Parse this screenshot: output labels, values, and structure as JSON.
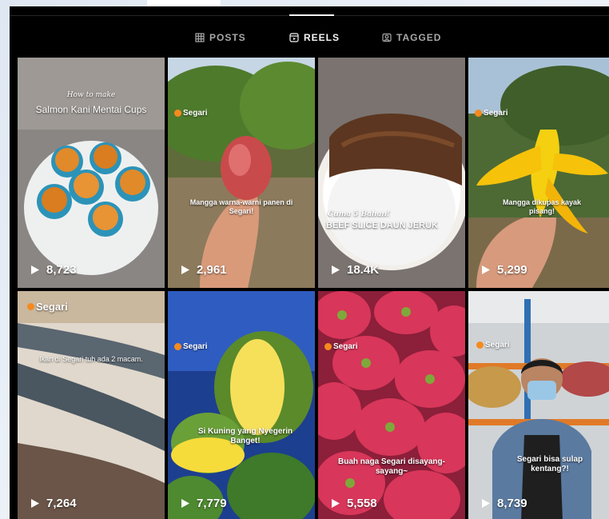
{
  "tabs": [
    {
      "label": "POSTS",
      "icon": "grid-icon",
      "active": false
    },
    {
      "label": "REELS",
      "icon": "reels-icon",
      "active": true
    },
    {
      "label": "TAGGED",
      "icon": "tagged-icon",
      "active": false
    }
  ],
  "reels": [
    {
      "views": "8,723",
      "pretitle": "How to make",
      "title": "Salmon Kani Mentai Cups",
      "brand": "",
      "caption": ""
    },
    {
      "views": "2,961",
      "pretitle": "",
      "title": "",
      "brand": "Segari",
      "caption": "Mangga warna-warni panen di Segari!"
    },
    {
      "views": "18.4K",
      "pretitle": "Cuma 5 Bahan!",
      "title": "BEEF SLICE DAUN JERUK",
      "brand": "",
      "caption": ""
    },
    {
      "views": "5,299",
      "pretitle": "",
      "title": "",
      "brand": "Segari",
      "caption": "Mangga dikupas kayak pisang!"
    },
    {
      "views": "7,264",
      "pretitle": "",
      "title": "",
      "brand": "Segari",
      "caption": "Ikan di Segari tuh ada 2 macam."
    },
    {
      "views": "7,779",
      "pretitle": "",
      "title": "",
      "brand": "Segari",
      "caption": "Si Kuning yang Nyegerin Banget!"
    },
    {
      "views": "5,558",
      "pretitle": "",
      "title": "",
      "brand": "Segari",
      "caption": "Buah naga Segari disayang-sayang~"
    },
    {
      "views": "8,739",
      "pretitle": "",
      "title": "",
      "brand": "Segari",
      "caption": "Segari bisa sulap kentang?!"
    }
  ],
  "colors": {
    "background": "#000000",
    "tab_active": "#f5f5f5",
    "tab_inactive": "#a8a8a8",
    "brand_orange": "#f58a1f"
  }
}
